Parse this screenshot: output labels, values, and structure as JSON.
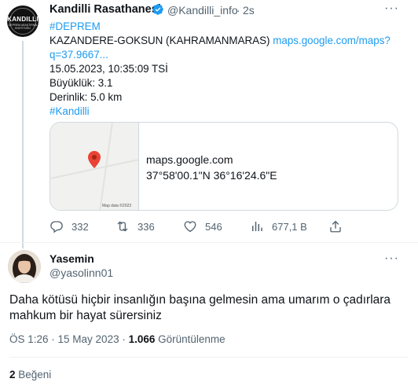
{
  "tweet": {
    "author_name": "Kandilli Rasathanesi",
    "author_handle": "@Kandilli_info",
    "separator": "·",
    "time": "2s",
    "avatar_text": "KANDILLI",
    "avatar_subtext": "DEPREM ARAŞTIRMA ENSTİTÜSÜ",
    "hashtag_deprem": "#DEPREM",
    "location": "KAZANDERE-GOKSUN (KAHRAMANMARAS)",
    "link_part1": "maps.google.com/maps?",
    "link_part2": "q=37.9667...",
    "datetime": "15.05.2023, 10:35:09 TSİ",
    "magnitude": "Büyüklük: 3.1",
    "depth": "Derinlik: 5.0 km",
    "hashtag_kandilli": "#Kandilli",
    "card": {
      "map_credit": "Map data ©2023",
      "domain": "maps.google.com",
      "coords": "37°58'00.1\"N 36°16'24.6\"E"
    },
    "actions": {
      "replies": "332",
      "retweets": "336",
      "likes": "546",
      "views": "677,1 B"
    }
  },
  "reply": {
    "author_name": "Yasemin",
    "author_handle": "@yasolinn01",
    "text_line1": "Daha kötüsü hiçbir insanlığın başına gelmesin ama umarım o çadırlara",
    "text_line2": "mahkum bir hayat sürersiniz",
    "time": "ÖS 1:26 · 15 May 2023 · ",
    "views_count": "1.066",
    "views_label": " Görüntülenme",
    "likes_count": "2",
    "likes_label": " Beğeni"
  },
  "colors": {
    "accent": "#1d9bf0",
    "text_secondary": "#536471",
    "pin": "#ea4335"
  }
}
